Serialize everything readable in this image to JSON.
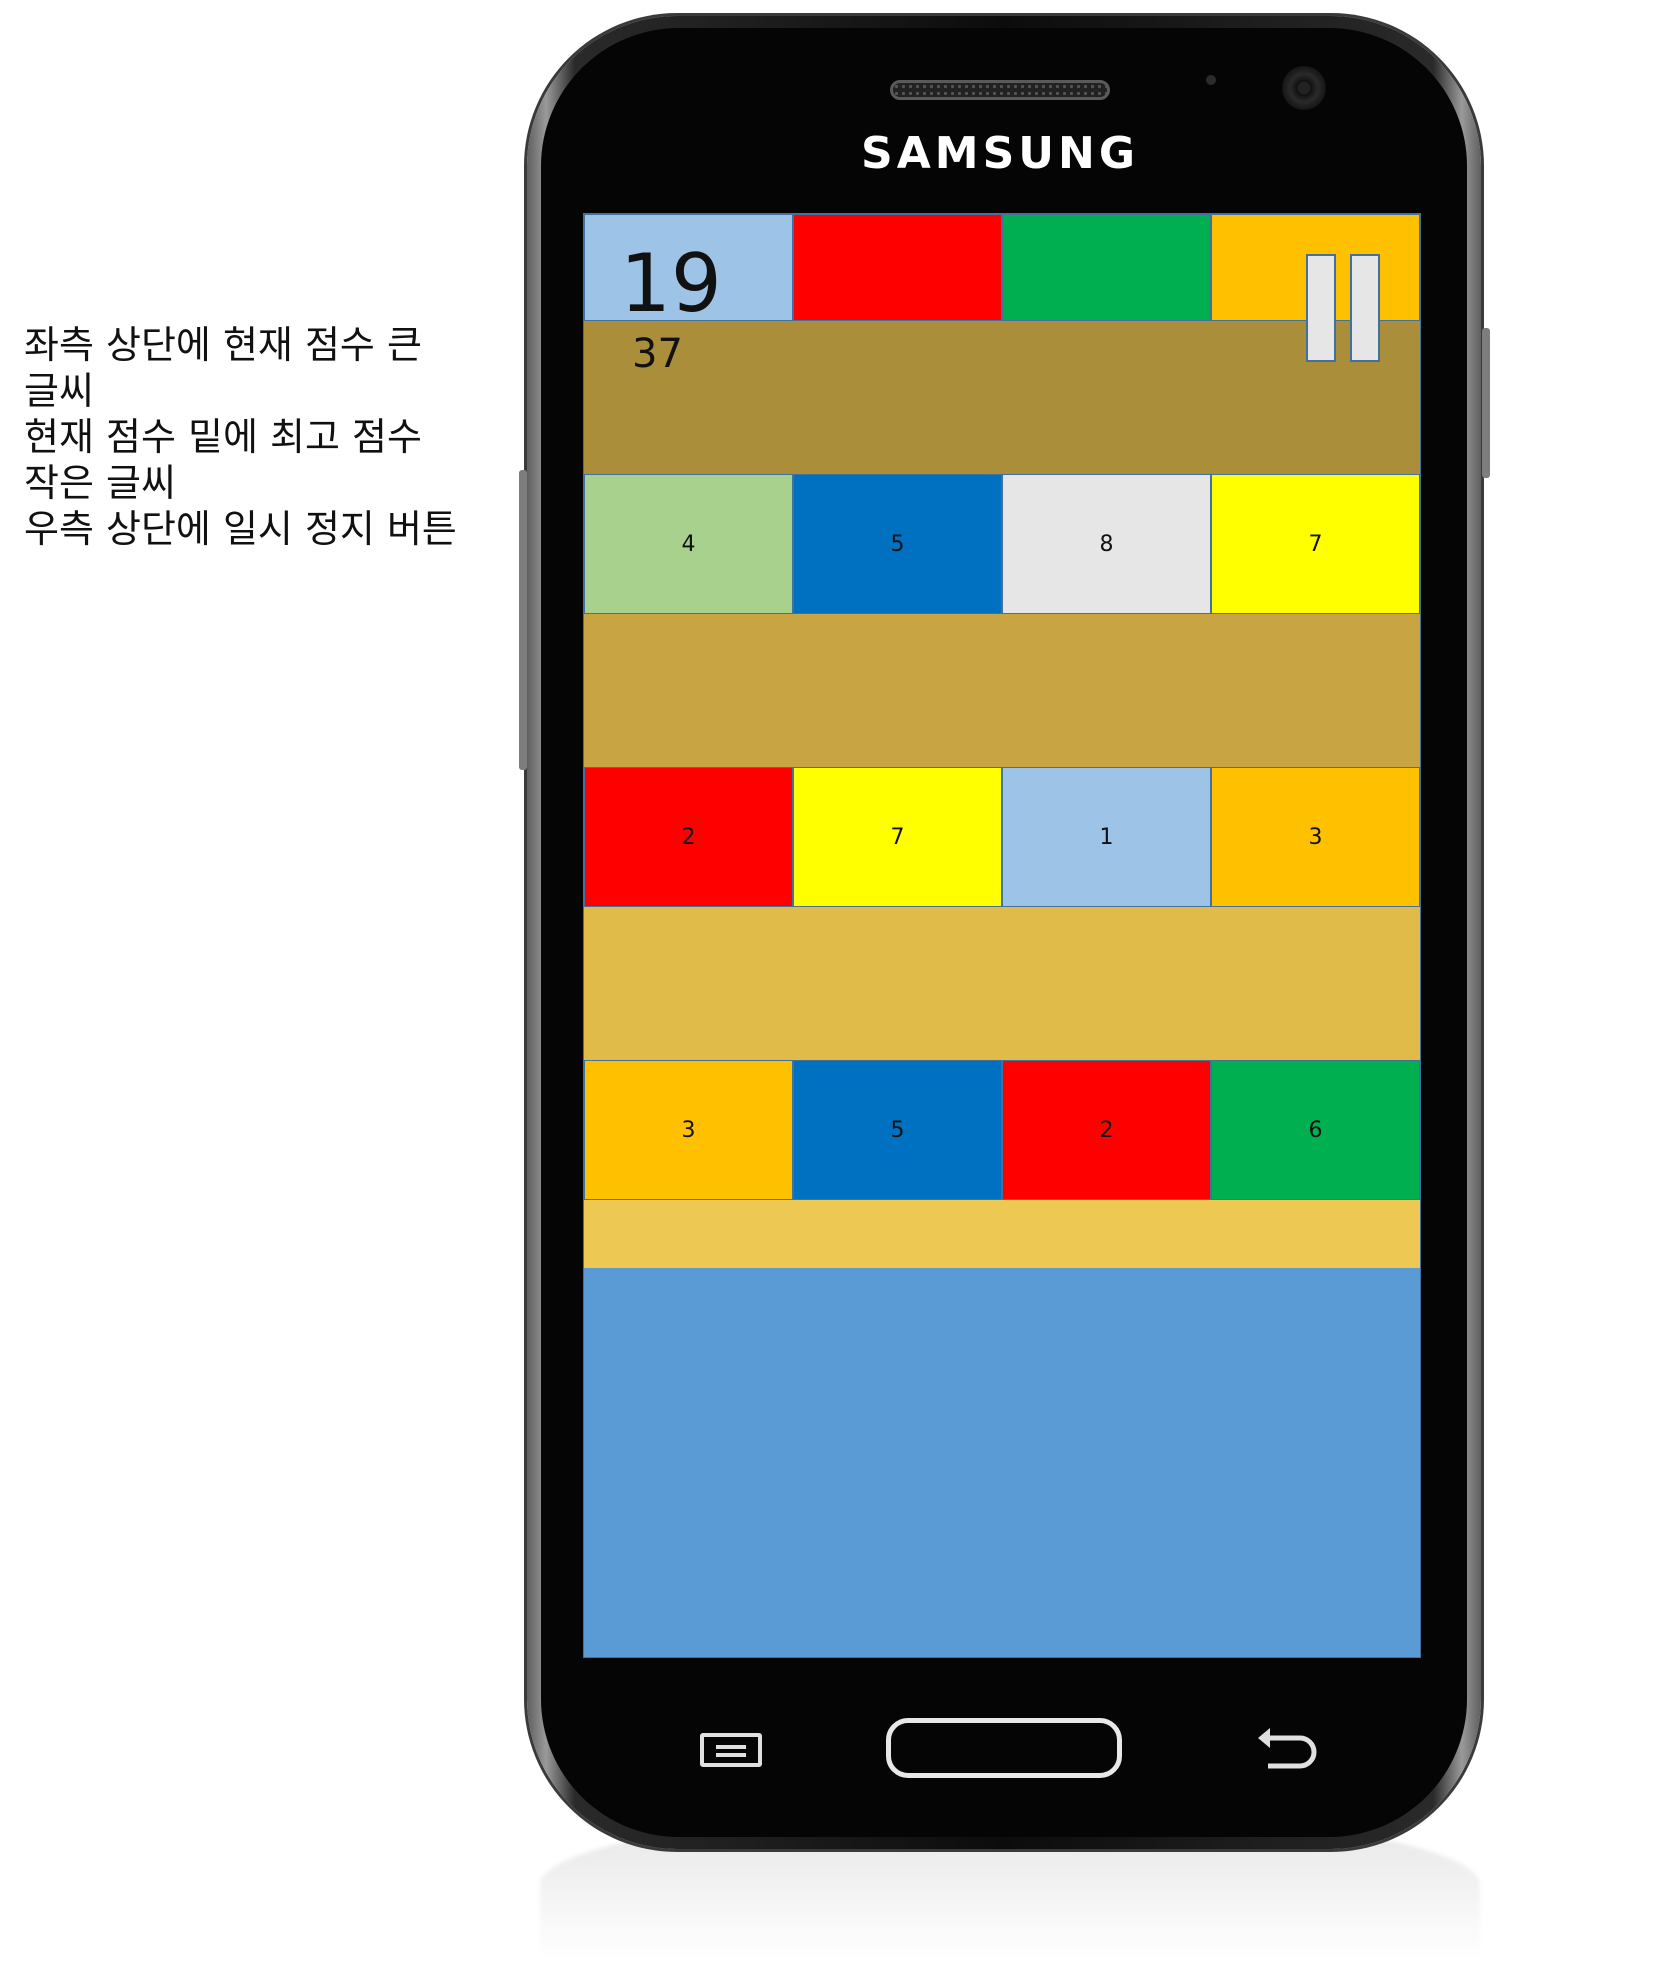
{
  "annotation": {
    "lines": [
      "좌측 상단에 현재 점수 큰 글씨",
      "현재 점수 밑에 최고 점수 작은 글씨",
      "우측 상단에 일시 정지 버튼"
    ]
  },
  "device": {
    "brand": "SAMSUNG",
    "menu_key_icon": "menu-icon",
    "home_key_icon": "home-button-icon",
    "back_key_icon": "back-arrow-icon"
  },
  "game": {
    "current_score": "19",
    "best_score": "37",
    "pause_icon": "pause-icon",
    "top_row_colors": [
      "#9dc3e6",
      "#ff0000",
      "#00b050",
      "#ffc000"
    ],
    "band_colors": [
      "#ab8e3a",
      "#c9a443",
      "#e0bb4a",
      "#edc953"
    ],
    "bottom_color": "#5b9bd5",
    "rows": [
      {
        "tiles": [
          {
            "label": "4",
            "color": "#a9d18e"
          },
          {
            "label": "5",
            "color": "#0070c0"
          },
          {
            "label": "8",
            "color": "#e7e6e6"
          },
          {
            "label": "7",
            "color": "#ffff00"
          }
        ]
      },
      {
        "tiles": [
          {
            "label": "2",
            "color": "#ff0000"
          },
          {
            "label": "7",
            "color": "#ffff00"
          },
          {
            "label": "1",
            "color": "#9dc3e6"
          },
          {
            "label": "3",
            "color": "#ffc000"
          }
        ]
      },
      {
        "tiles": [
          {
            "label": "3",
            "color": "#ffc000"
          },
          {
            "label": "5",
            "color": "#0070c0"
          },
          {
            "label": "2",
            "color": "#ff0000"
          },
          {
            "label": "6",
            "color": "#00b050"
          }
        ]
      }
    ]
  }
}
